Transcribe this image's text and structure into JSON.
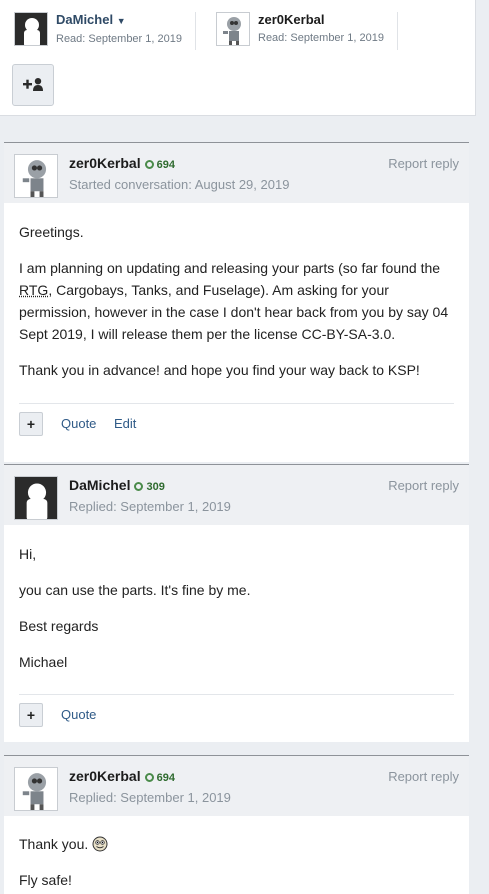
{
  "participants": [
    {
      "name": "DaMichel",
      "read": "Read: September 1, 2019",
      "avatar": "silhouette-avatar"
    },
    {
      "name": "zer0Kerbal",
      "read": "Read: September 1, 2019",
      "avatar": "kerbal-robot-avatar"
    }
  ],
  "add_participant_icons": "plus-user-icon",
  "posts": [
    {
      "author": "zer0Kerbal",
      "reputation": "694",
      "subline": "Started conversation: August 29, 2019",
      "report": "Report reply",
      "paragraphs": [
        "Greetings.",
        "I am planning on updating and releasing your parts (so far found the RTG, Cargobays, Tanks, and Fuselage). Am asking for your permission, however in the case I don't hear back from you by say 04 Sept 2019, I will release them per the license CC-BY-SA-3.0.",
        "Thank you in advance! and hope you find your way back to KSP!"
      ],
      "actions": [
        "Quote",
        "Edit"
      ]
    },
    {
      "author": "DaMichel",
      "reputation": "309",
      "subline": "Replied: September 1, 2019",
      "report": "Report reply",
      "paragraphs": [
        "Hi,",
        "you can use the parts. It's fine by me.",
        "Best regards",
        "Michael"
      ],
      "actions": [
        "Quote"
      ]
    },
    {
      "author": "zer0Kerbal",
      "reputation": "694",
      "subline": "Replied: September 1, 2019",
      "report": "Report reply",
      "paragraphs": [
        "Thank you.",
        "Fly safe!"
      ]
    }
  ],
  "p1_rtg": "RTG",
  "p1_pre": "I am planning on updating and releasing your parts (so far found the ",
  "p1_post": ", Cargobays, Tanks, and Fuselage). Am asking for your permission, however in the case I don't hear back from you by say 04 Sept 2019, I will release them per the license CC-BY-SA-3.0."
}
